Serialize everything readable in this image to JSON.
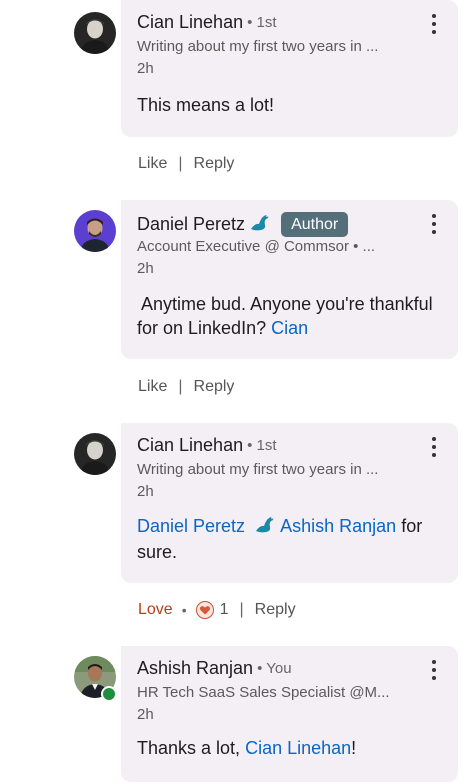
{
  "comments": [
    {
      "name": "Cian Linehan",
      "degree": "• 1st",
      "headline": "Writing about my first two years in ...",
      "time": "2h",
      "text": "This means a lot!",
      "actions": {
        "like": "Like",
        "sep": "|",
        "reply": "Reply"
      }
    },
    {
      "name": "Daniel Peretz",
      "badge": "Author",
      "headline": "Account Executive @ Commsor • ...",
      "time": "2h",
      "text": "Anytime bud. Anyone you're thankful for on LinkedIn?",
      "mention": "Cian",
      "actions": {
        "like": "Like",
        "sep": "|",
        "reply": "Reply"
      }
    },
    {
      "name": "Cian Linehan",
      "degree": "• 1st",
      "headline": "Writing about my first two years in ...",
      "time": "2h",
      "mention1": "Daniel Peretz",
      "mention2": "Ashish Ranjan",
      "text_after": "for sure.",
      "actions": {
        "reaction": "Love",
        "dot": "•",
        "count": "1",
        "sep": "|",
        "reply": "Reply"
      }
    },
    {
      "name": "Ashish Ranjan",
      "degree": "• You",
      "headline": "HR Tech SaaS Sales Specialist @M...",
      "time": "2h",
      "text": "Thanks a lot,",
      "mention": "Cian Linehan",
      "text_after": "!"
    }
  ],
  "colors": {
    "bubble": "#f4eff4",
    "mention": "#0a66c2",
    "author_badge": "#546e7a",
    "love": "#b24020",
    "online": "#1e8e3e"
  }
}
